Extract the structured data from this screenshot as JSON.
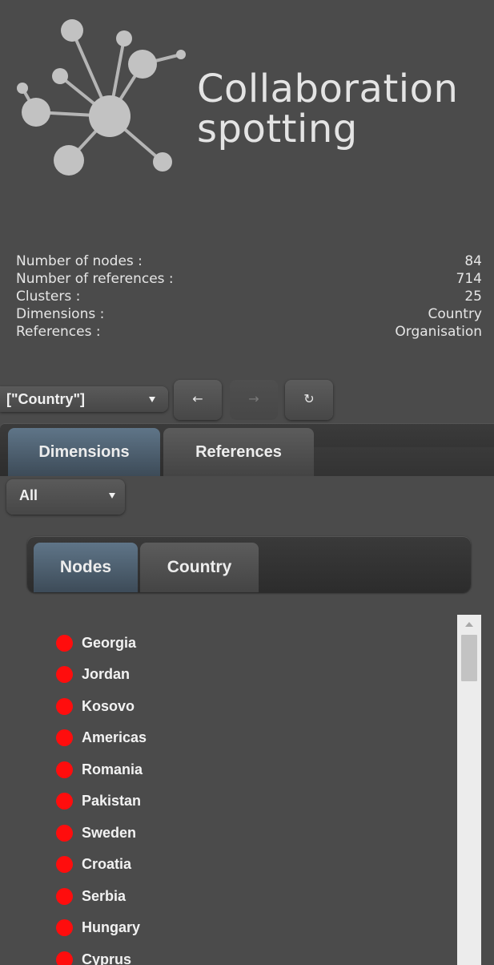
{
  "logo": {
    "line1": "Collaboration",
    "line2": "spotting"
  },
  "stats": [
    {
      "label": "Number of nodes :",
      "value": "84"
    },
    {
      "label": "Number of references :",
      "value": "714"
    },
    {
      "label": "Clusters :",
      "value": "25"
    },
    {
      "label": "Dimensions :",
      "value": "Country"
    },
    {
      "label": "References :",
      "value": "Organisation"
    }
  ],
  "toolbar": {
    "dimension_select_value": "[\"Country\"]",
    "back_icon": "arrow-left-icon",
    "forward_icon": "arrow-right-icon",
    "refresh_icon": "refresh-icon",
    "back_glyph": "←",
    "forward_glyph": "→",
    "refresh_glyph": "↻"
  },
  "tabs": {
    "dimensions_label": "Dimensions",
    "references_label": "References"
  },
  "filter": {
    "selected": "All"
  },
  "subtabs": {
    "nodes_label": "Nodes",
    "country_label": "Country"
  },
  "nodes": [
    "Georgia",
    "Jordan",
    "Kosovo",
    "Americas",
    "Romania",
    "Pakistan",
    "Sweden",
    "Croatia",
    "Serbia",
    "Hungary",
    "Cyprus"
  ],
  "colors": {
    "background": "#4b4b4b",
    "node_dot": "#ff0d0d",
    "active_tab": "#4f6374",
    "logo": "#c8c8c8"
  }
}
